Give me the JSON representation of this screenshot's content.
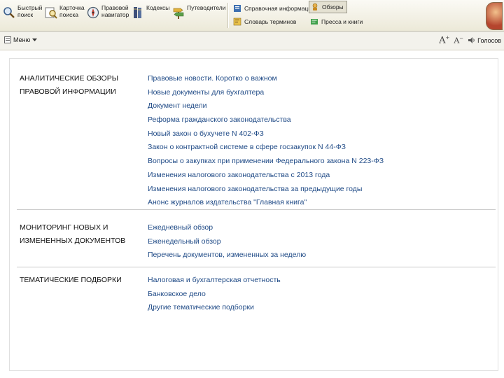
{
  "toolbar": {
    "buttons": [
      {
        "label": "Быстрый поиск",
        "icon": "search-icon"
      },
      {
        "label": "Карточка поиска",
        "icon": "magnifier-card-icon"
      },
      {
        "label": "Правовой навигатор",
        "icon": "compass-icon"
      },
      {
        "label": "Кодексы",
        "icon": "books-icon"
      },
      {
        "label": "Путеводители",
        "icon": "signpost-icon"
      }
    ],
    "reference": {
      "label": "Справочная информация",
      "icon": "book-icon"
    },
    "reviews": {
      "label": "Обзоры",
      "icon": "reviews-icon"
    },
    "terms": {
      "label": "Словарь терминов",
      "icon": "dictionary-icon"
    },
    "press": {
      "label": "Пресса и книги",
      "icon": "press-icon"
    }
  },
  "bar2": {
    "menu_label": "Меню",
    "voice_label": "Голосов"
  },
  "sections": [
    {
      "title": "АНАЛИТИЧЕСКИЕ ОБЗОРЫ ПРАВОВОЙ ИНФОРМАЦИИ",
      "links": [
        "Правовые новости. Коротко о важном",
        "Новые документы для бухгалтера",
        "Документ недели",
        "Реформа гражданского законодательства",
        "Новый закон о бухучете N 402-ФЗ",
        "Закон о контрактной системе в сфере госзакупок N 44-ФЗ",
        "Вопросы о закупках при применении Федерального закона N 223-ФЗ",
        "Изменения налогового законодательства с 2013 года",
        "Изменения налогового законодательства за предыдущие годы",
        "Анонс журналов издательства \"Главная книга\""
      ]
    },
    {
      "title": "МОНИТОРИНГ НОВЫХ И ИЗМЕНЕННЫХ ДОКУМЕНТОВ",
      "links": [
        "Ежедневный обзор",
        "Еженедельный обзор",
        "Перечень документов, измененных за неделю"
      ]
    },
    {
      "title": "ТЕМАТИЧЕСКИЕ ПОДБОРКИ",
      "links": [
        "Налоговая и бухгалтерская отчетность",
        "Банковское дело",
        "Другие тематические подборки"
      ]
    }
  ]
}
